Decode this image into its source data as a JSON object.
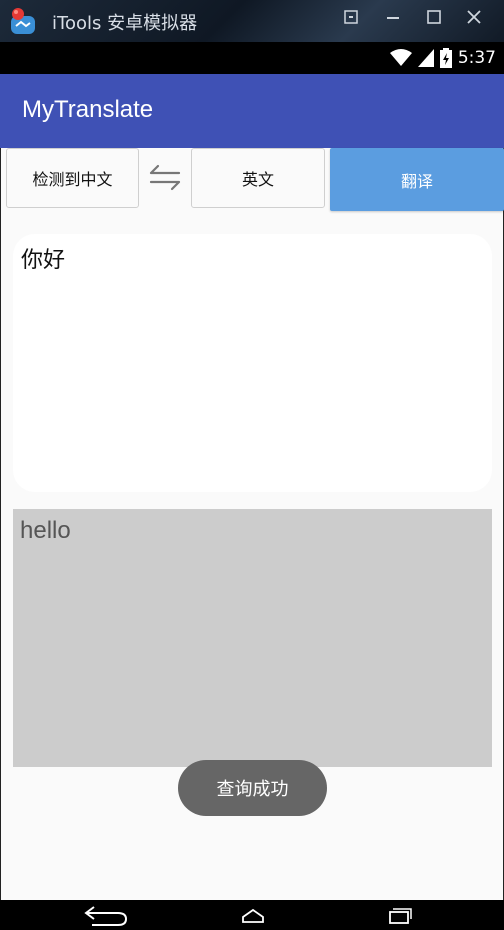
{
  "emulator": {
    "title": "iTools 安卓模拟器",
    "controls": [
      "restore-icon",
      "minimize-icon",
      "maximize-icon",
      "close-icon"
    ]
  },
  "statusbar": {
    "time": "5:37",
    "icons": [
      "wifi-icon",
      "signal-icon",
      "battery-icon"
    ]
  },
  "appbar": {
    "title": "MyTranslate",
    "color": "#3f51b5"
  },
  "languages": {
    "source_label": "检测到中文",
    "target_label": "英文",
    "swap_icon": "swap-icon"
  },
  "translate_button": {
    "label": "翻译",
    "color": "#5b9de0"
  },
  "input": {
    "value": "你好"
  },
  "output": {
    "value": "hello"
  },
  "toast": {
    "text": "查询成功"
  },
  "navbar": {
    "icons": [
      "back-icon",
      "home-icon",
      "recents-icon"
    ]
  }
}
